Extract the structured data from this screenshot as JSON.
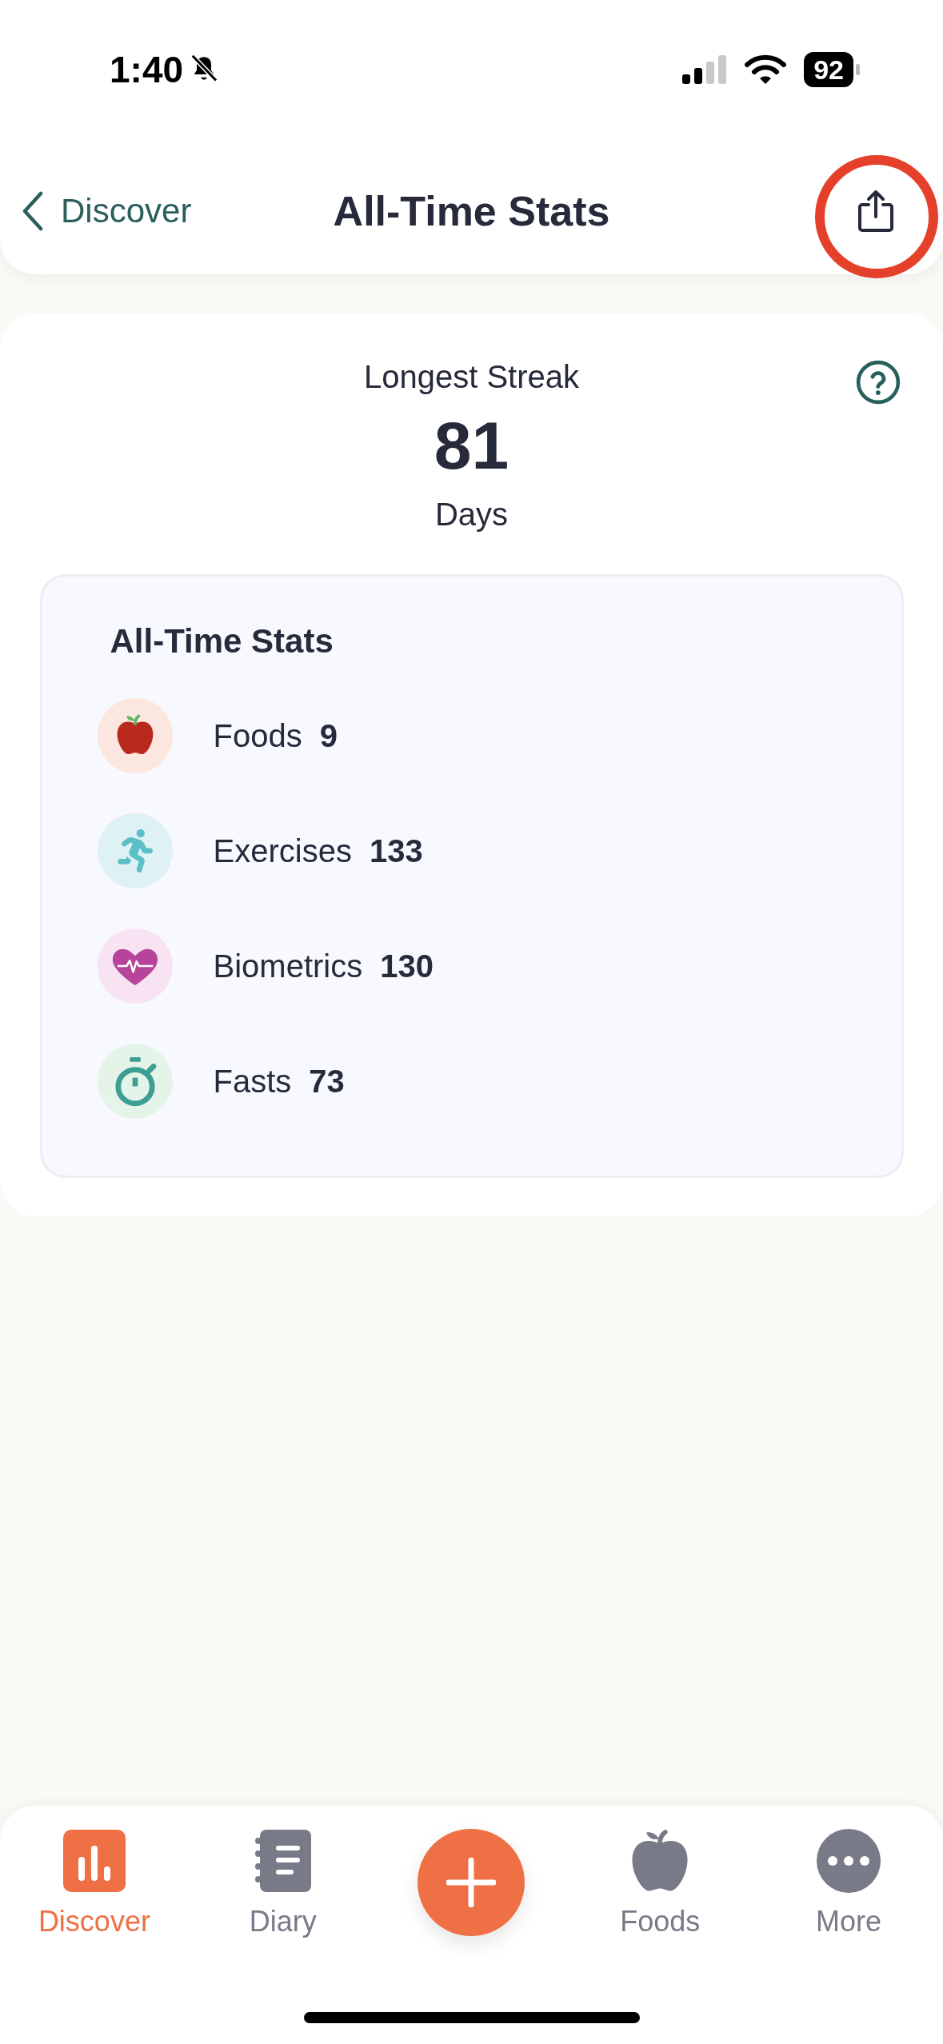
{
  "status_bar": {
    "time": "1:40",
    "battery": "92"
  },
  "header": {
    "back_label": "Discover",
    "title": "All-Time Stats"
  },
  "streak": {
    "label": "Longest Streak",
    "value": "81",
    "unit": "Days"
  },
  "stats": {
    "title": "All-Time Stats",
    "items": [
      {
        "kind": "food",
        "label": "Foods",
        "value": "9"
      },
      {
        "kind": "exercise",
        "label": "Exercises",
        "value": "133"
      },
      {
        "kind": "biometric",
        "label": "Biometrics",
        "value": "130"
      },
      {
        "kind": "fast",
        "label": "Fasts",
        "value": "73"
      }
    ]
  },
  "tab_bar": {
    "tabs": [
      {
        "kind": "discover",
        "label": "Discover",
        "selected": true
      },
      {
        "kind": "diary",
        "label": "Diary",
        "selected": false
      },
      {
        "kind": "foods",
        "label": "Foods",
        "selected": false
      },
      {
        "kind": "more",
        "label": "More",
        "selected": false
      }
    ]
  }
}
